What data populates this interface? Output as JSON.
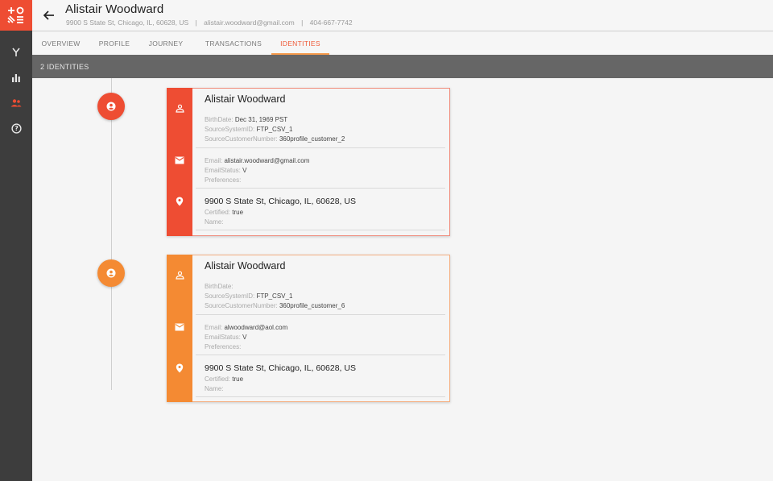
{
  "app": {
    "logo_icon": "app-logo-icon",
    "nav": [
      {
        "icon": "merge-icon",
        "label": "Merge"
      },
      {
        "icon": "bar-chart-icon",
        "label": "Analytics"
      },
      {
        "icon": "people-icon",
        "label": "Customers",
        "active": true
      },
      {
        "icon": "help-icon",
        "label": "Help"
      }
    ]
  },
  "header": {
    "title": "Alistair Woodward",
    "address": "9900 S State St,  Chicago, IL, 60628, US",
    "email": "alistair.woodward@gmail.com",
    "phone": "404-667-7742",
    "separator": "|"
  },
  "tabs": [
    {
      "label": "OVERVIEW",
      "active": false
    },
    {
      "label": "PROFILE",
      "active": false
    },
    {
      "label": "JOURNEY",
      "active": false
    },
    {
      "label": "TRANSACTIONS",
      "active": false
    },
    {
      "label": "IDENTITIES",
      "active": true
    }
  ],
  "count_label": "2 IDENTITIES",
  "colors": {
    "primary": "#ee4d33",
    "secondary": "#f48a33",
    "active_tab": "#ef5b39",
    "tab_underline": "#f59a4c"
  },
  "identities": [
    {
      "color": "#ee4d33",
      "border": "#f08e7e",
      "name": "Alistair Woodward",
      "birthdate_label": "BirthDate:",
      "birthdate": "Dec 31, 1969 PST",
      "source_system_label": "SourceSystemID:",
      "source_system": "FTP_CSV_1",
      "source_customer_label": "SourceCustomerNumber:",
      "source_customer": "360profile_customer_2",
      "email_label": "Email:",
      "email": "alistair.woodward@gmail.com",
      "email_status_label": "EmailStatus:",
      "email_status": "V",
      "preferences_label": "Preferences:",
      "preferences": "",
      "address": "9900 S State St, Chicago, IL, 60628, US",
      "certified_label": "Certified:",
      "certified": "true",
      "addr_name_label": "Name:",
      "addr_name": ""
    },
    {
      "color": "#f48a33",
      "border": "#f5b184",
      "name": "Alistair Woodward",
      "birthdate_label": "BirthDate:",
      "birthdate": "",
      "source_system_label": "SourceSystemID:",
      "source_system": "FTP_CSV_1",
      "source_customer_label": "SourceCustomerNumber:",
      "source_customer": "360profile_customer_6",
      "email_label": "Email:",
      "email": "alwoodward@aol.com",
      "email_status_label": "EmailStatus:",
      "email_status": "V",
      "preferences_label": "Preferences:",
      "preferences": "",
      "address": "9900 S State St, Chicago, IL, 60628, US",
      "certified_label": "Certified:",
      "certified": "true",
      "addr_name_label": "Name:",
      "addr_name": ""
    }
  ]
}
